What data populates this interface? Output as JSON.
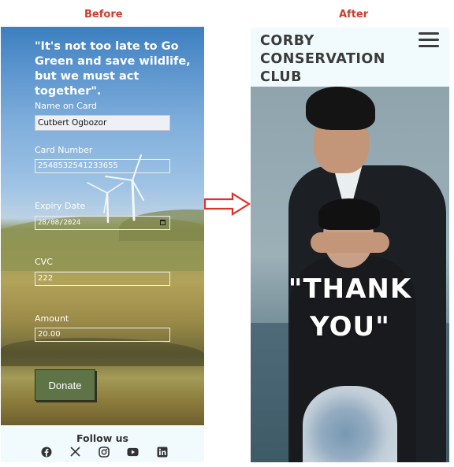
{
  "captions": {
    "before": "Before",
    "after": "After",
    "color": "#d03a2c"
  },
  "before": {
    "quote": "\"It's not too late to Go Green and save wildlife, but we must act together\".",
    "form": {
      "name_label": "Name on Card",
      "name_value": "Cutbert Ogbozor",
      "card_label": "Card Number",
      "card_value": "2548532541233655",
      "expiry_label": "Expiry Date",
      "expiry_value": "28/08/2024",
      "cvc_label": "CVC",
      "cvc_value": "222",
      "amount_label": "Amount",
      "amount_value": "20.00"
    },
    "donate_label": "Donate",
    "footer": {
      "heading": "Follow us",
      "icons": [
        "facebook-icon",
        "x-icon",
        "instagram-icon",
        "youtube-icon",
        "linkedin-icon"
      ]
    }
  },
  "arrow": {
    "color": "#e0302a"
  },
  "after": {
    "club_title_lines": [
      "CORBY",
      "CONSERVATION",
      "CLUB"
    ],
    "hero_text_lines": [
      "\"THANK",
      "YOU\""
    ],
    "menu_icon": "hamburger-menu-icon"
  }
}
